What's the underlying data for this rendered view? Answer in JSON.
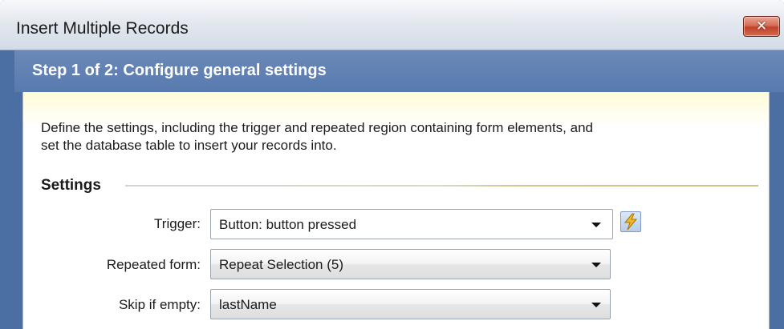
{
  "window": {
    "title": "Insert Multiple Records",
    "close_label": "✕"
  },
  "step": {
    "title": "Step 1 of 2: Configure general settings"
  },
  "content": {
    "description_line1": "Define the settings, including the trigger and repeated region containing form elements, and",
    "description_line2": "set the database table to insert your records into.",
    "section_title": "Settings",
    "fields": [
      {
        "label": "Trigger:",
        "value": "Button: button pressed"
      },
      {
        "label": "Repeated form:",
        "value": "Repeat Selection (5)"
      },
      {
        "label": "Skip if empty:",
        "value": "lastName"
      }
    ]
  },
  "icons": {
    "trigger_action": "lightning-bolt-icon"
  },
  "colors": {
    "window_frame": "#4b6fa3",
    "step_bar": "#587aae",
    "content_bg_top": "#fffbd6",
    "close_button": "#c0432a",
    "bolt": "#f2b81c"
  }
}
